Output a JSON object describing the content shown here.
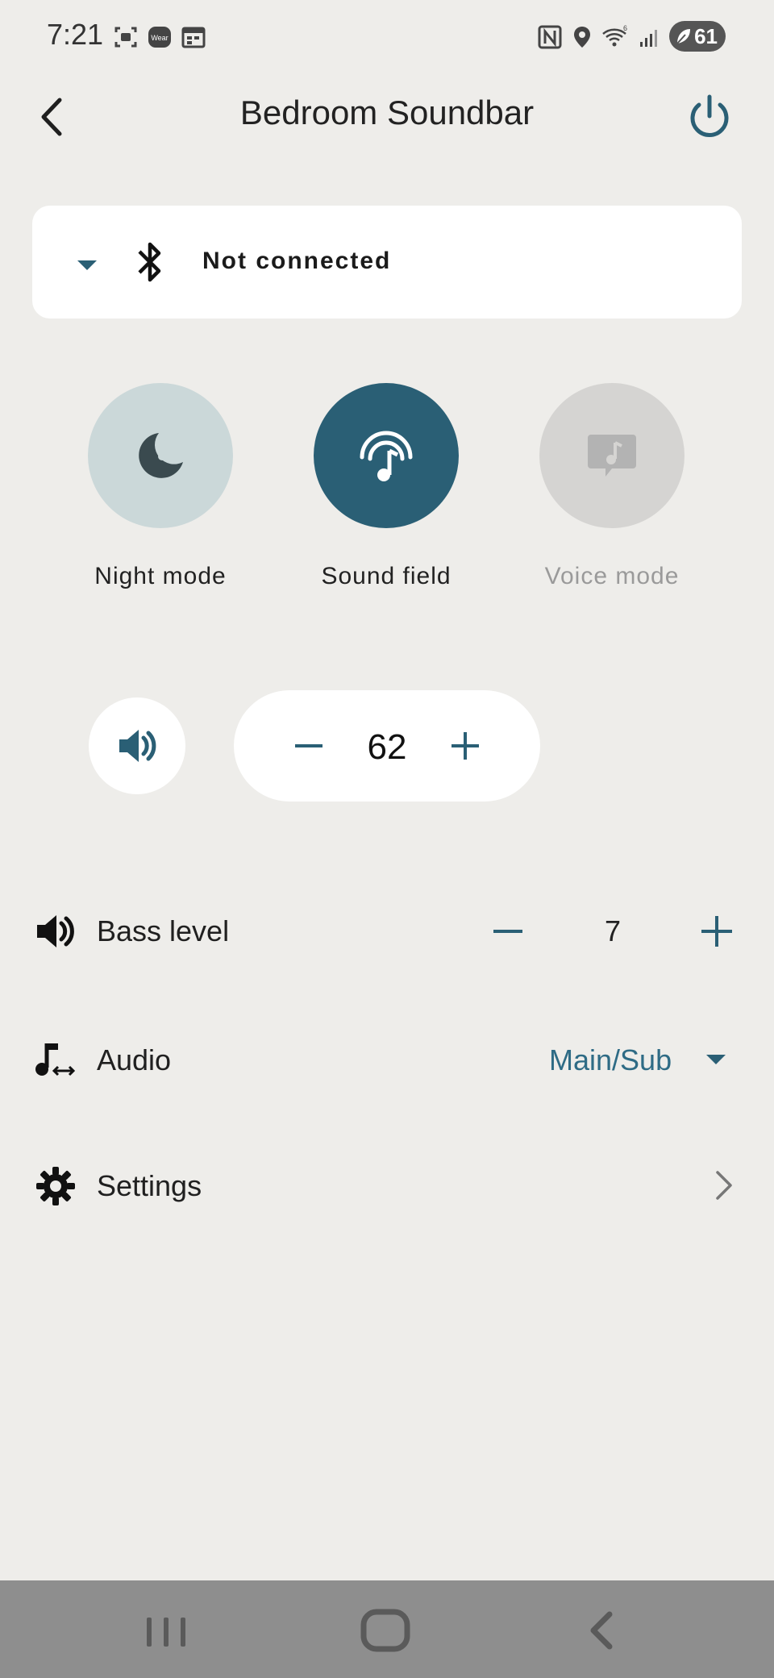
{
  "status_bar": {
    "time": "7:21",
    "battery": "61",
    "icons": [
      "screenshot-icon",
      "wear-icon",
      "calendar-icon",
      "nfc-icon",
      "location-icon",
      "wifi-icon",
      "signal-icon",
      "battery-icon"
    ]
  },
  "header": {
    "title": "Bedroom Soundbar"
  },
  "bluetooth": {
    "status": "Not connected"
  },
  "modes": [
    {
      "label": "Night mode",
      "state": "off"
    },
    {
      "label": "Sound field",
      "state": "on"
    },
    {
      "label": "Voice mode",
      "state": "disabled"
    }
  ],
  "volume": {
    "value": "62"
  },
  "bass": {
    "label": "Bass level",
    "value": "7"
  },
  "audio": {
    "label": "Audio",
    "value": "Main/Sub"
  },
  "settings": {
    "label": "Settings"
  },
  "colors": {
    "background": "#eeedea",
    "accent": "#2a5f75",
    "accent_text": "#2e6b85",
    "night_mode_bg": "#cbd8d9",
    "voice_mode_bg": "#d5d4d2",
    "disabled_text": "#9a9a9a",
    "navbar": "#8e8e8e"
  }
}
